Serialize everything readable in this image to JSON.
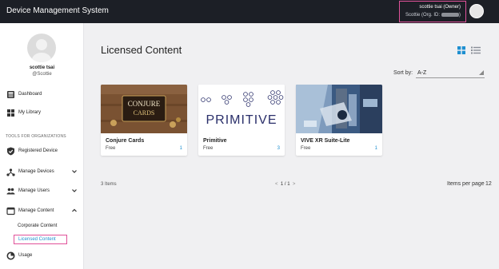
{
  "app": {
    "title": "Device Management System"
  },
  "user": {
    "name": "scottie tsai (Owner)",
    "org_prefix": "Scottie (Org. ID:",
    "org_suffix": ")"
  },
  "profile": {
    "name": "scottie tsai",
    "handle": "@Scottie"
  },
  "sidebar": {
    "dashboard": "Dashboard",
    "library": "My Library",
    "section_label": "TOOLS FOR ORGANIZATIONS",
    "registered_device": "Registered Device",
    "manage_devices": "Manage Devices",
    "manage_users": "Manage Users",
    "manage_content": "Manage Content",
    "corporate_content": "Corporate Content",
    "licensed_content": "Licensed Content",
    "usage": "Usage"
  },
  "main": {
    "title": "Licensed Content",
    "sort_label": "Sort by:",
    "sort_value": "A-Z",
    "items_count": "3 Items",
    "pagination": {
      "prev": "<",
      "current": "1 / 1",
      "next": ">"
    },
    "per_page_label": "Items per page",
    "per_page_value": "12"
  },
  "cards": [
    {
      "title": "Conjure Cards",
      "price": "Free",
      "count": "1",
      "thumb_text_1": "CONJURE",
      "thumb_text_2": "CARDS"
    },
    {
      "title": "Primitive",
      "price": "Free",
      "count": "3",
      "thumb_text": "PRIMITIVE"
    },
    {
      "title": "VIVE XR Suite-Lite",
      "price": "Free",
      "count": "1"
    }
  ],
  "colors": {
    "topbar": "#1c1f26",
    "accent_pink": "#e0529a",
    "link_blue": "#1e8fd0",
    "view_active": "#1e8fd0"
  },
  "icons": [
    "dashboard-icon",
    "library-icon",
    "shield-icon",
    "devices-icon",
    "users-icon",
    "content-icon",
    "usage-icon",
    "grid-view-icon",
    "list-view-icon"
  ]
}
